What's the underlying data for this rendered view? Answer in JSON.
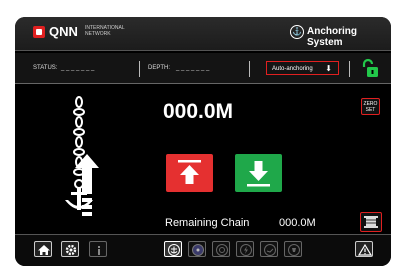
{
  "header": {
    "brand": "QNN",
    "brand_sub": "INTERNATIONAL NETWORK",
    "title": "Anchoring System"
  },
  "status": {
    "status_label": "STATUS:",
    "status_value": "_ _ _ _ _ _ _",
    "depth_label": "DEPTH:",
    "depth_value": "_ _ _ _ _ _ _",
    "mode_value": "Auto-anchoring"
  },
  "main": {
    "chain_reading": "000.0M",
    "zero_button": "ZERO SET",
    "remaining_label": "Remaining Chain",
    "remaining_value": "000.0M"
  },
  "colors": {
    "accent_red": "#e53030",
    "accent_green": "#1fa84a"
  }
}
